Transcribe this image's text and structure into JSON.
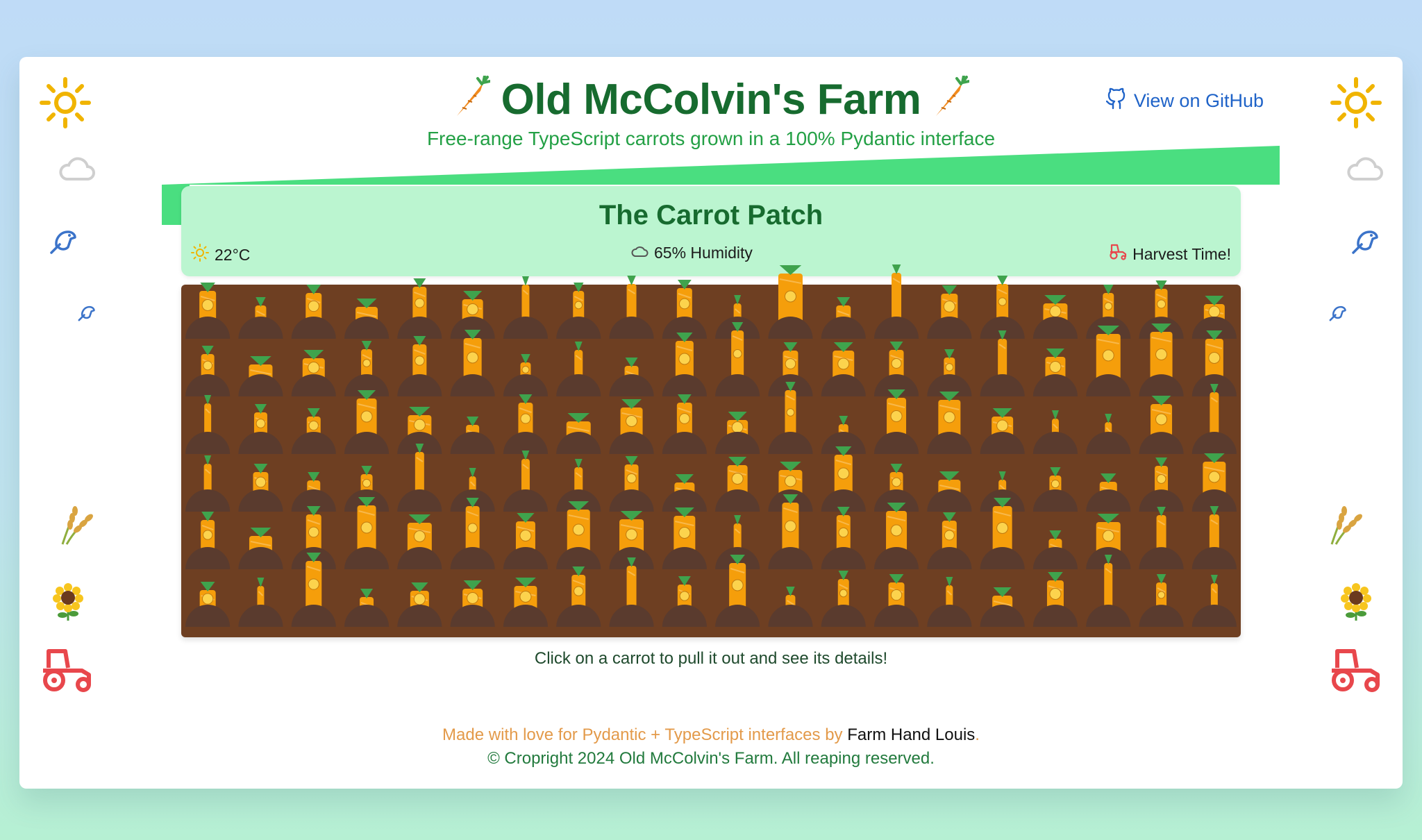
{
  "header": {
    "title": "Old McColvin's Farm",
    "subtitle": "Free-range TypeScript carrots grown in a 100% Pydantic interface",
    "github_label": "View on GitHub",
    "title_icon": "carrot-icon"
  },
  "patch": {
    "title": "The Carrot Patch",
    "temperature": "22°C",
    "humidity": "65% Humidity",
    "harvest": "Harvest Time!",
    "grid_columns": 20,
    "grid_rows": 6,
    "hint": "Click on a carrot to pull it out and see its details!"
  },
  "footer": {
    "made_with": "Made with love for Pydantic + TypeScript interfaces by ",
    "author": "Farm Hand Louis",
    "period": ".",
    "copyright": "© Cropright 2024 Old McColvin's Farm. All reaping reserved."
  },
  "decorations": [
    "sun-icon",
    "cloud-icon",
    "bird-icon",
    "small-bird-icon",
    "wheat-icon",
    "sunflower-icon",
    "tractor-icon"
  ],
  "colors": {
    "title_green": "#176b2f",
    "subtitle_green": "#23a045",
    "banner_green": "#4ade80",
    "patch_header_bg": "#bbf5d0",
    "soil": "#6e3f22",
    "mound": "#5a3b2e",
    "carrot": "#f59e0b",
    "carrot_top": "#3fa34d",
    "link_blue": "#1f63c8",
    "footer_orange": "#e39a4a",
    "tractor_red": "#e8474c",
    "sun_yellow": "#f0b400"
  }
}
